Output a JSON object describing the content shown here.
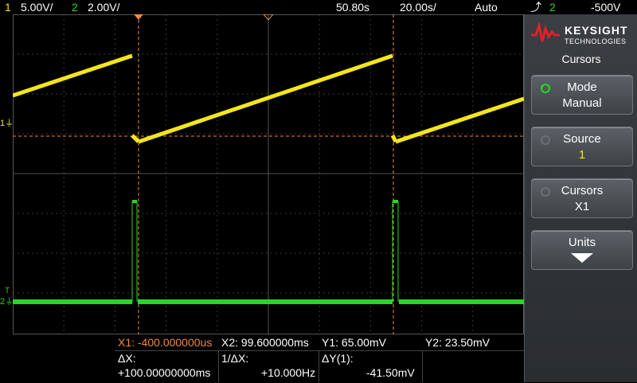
{
  "topbar": {
    "ch1_num": "1",
    "ch1_scale": "5.00V/",
    "ch2_num": "2",
    "ch2_scale": "2.00V/",
    "time_ref": "50.80s",
    "timebase": "20.00s/",
    "trigger_mode": "Auto",
    "trigger_source": "2",
    "trigger_level": "-500V"
  },
  "readout": {
    "x1": "X1: -400.000000us",
    "x2": "X2:  99.600000ms",
    "y1": "Y1:  65.00mV",
    "y2": "Y2:  23.50mV",
    "dx_label": "ΔX:",
    "dx_value": "+100.00000000ms",
    "inv_dx_label": "1/ΔX:",
    "inv_dx_value": "+10.000Hz",
    "dy_label": "ΔY(1):",
    "dy_value": "-41.50mV"
  },
  "panel": {
    "logo_line1": "KEYSIGHT",
    "logo_line2": "TECHNOLOGIES",
    "menu_title": "Cursors",
    "softkeys": [
      {
        "label": "Mode",
        "value": "Manual"
      },
      {
        "label": "Source",
        "value": "1"
      },
      {
        "label": "Cursors",
        "value": "X1"
      },
      {
        "label": "Units",
        "value": ""
      }
    ]
  },
  "markers": {
    "ch1": "1",
    "ch2": "2",
    "trig": "T"
  },
  "colors": {
    "ch1": "#f5e61a",
    "ch2": "#28d628",
    "cursor": "#f08a3c",
    "grid": "#3a3a3a",
    "accent": "#e0202a"
  }
}
